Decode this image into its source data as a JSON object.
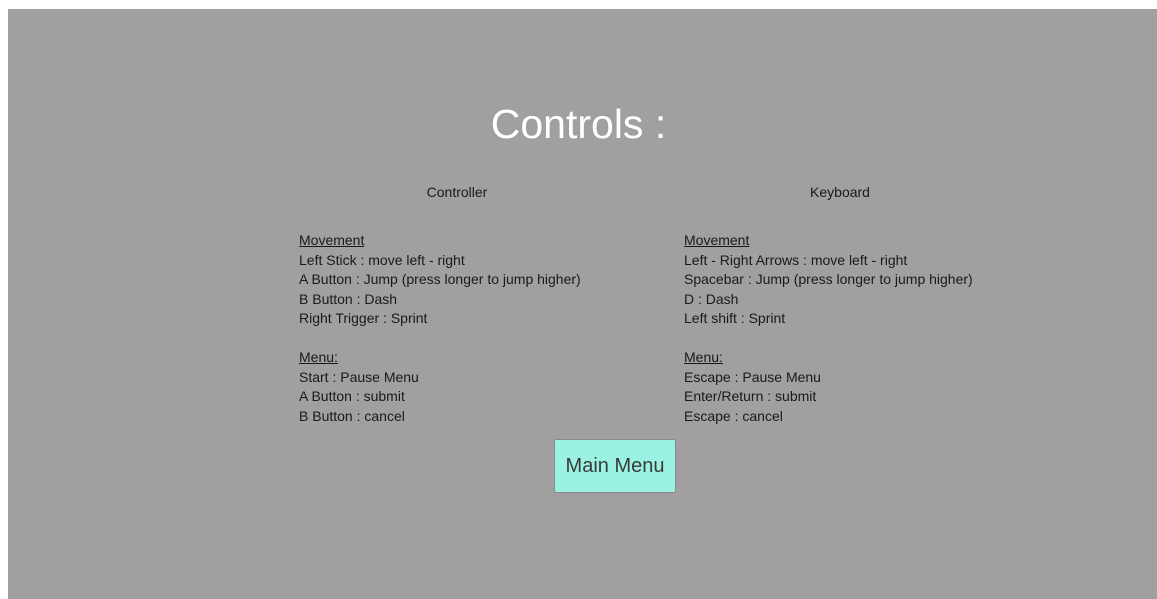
{
  "title": "Controls :",
  "controller": {
    "heading": "Controller",
    "movement_title": "Movement",
    "movement": [
      "Left Stick : move left - right",
      "A Button : Jump (press longer to jump higher)",
      "B Button : Dash",
      "Right Trigger : Sprint"
    ],
    "menu_title": "Menu:",
    "menu": [
      "Start : Pause Menu",
      "A Button : submit",
      "B Button : cancel"
    ]
  },
  "keyboard": {
    "heading": "Keyboard",
    "movement_title": "Movement",
    "movement": [
      "Left - Right Arrows : move left - right",
      "Spacebar : Jump (press longer to jump higher)",
      "D : Dash",
      "Left shift : Sprint"
    ],
    "menu_title": "Menu:",
    "menu": [
      "Escape : Pause Menu",
      "Enter/Return : submit",
      "Escape : cancel"
    ]
  },
  "main_menu_button": "Main Menu",
  "colors": {
    "background": "#a19f9f",
    "button": "#9af2e2",
    "title": "#ffffff"
  }
}
